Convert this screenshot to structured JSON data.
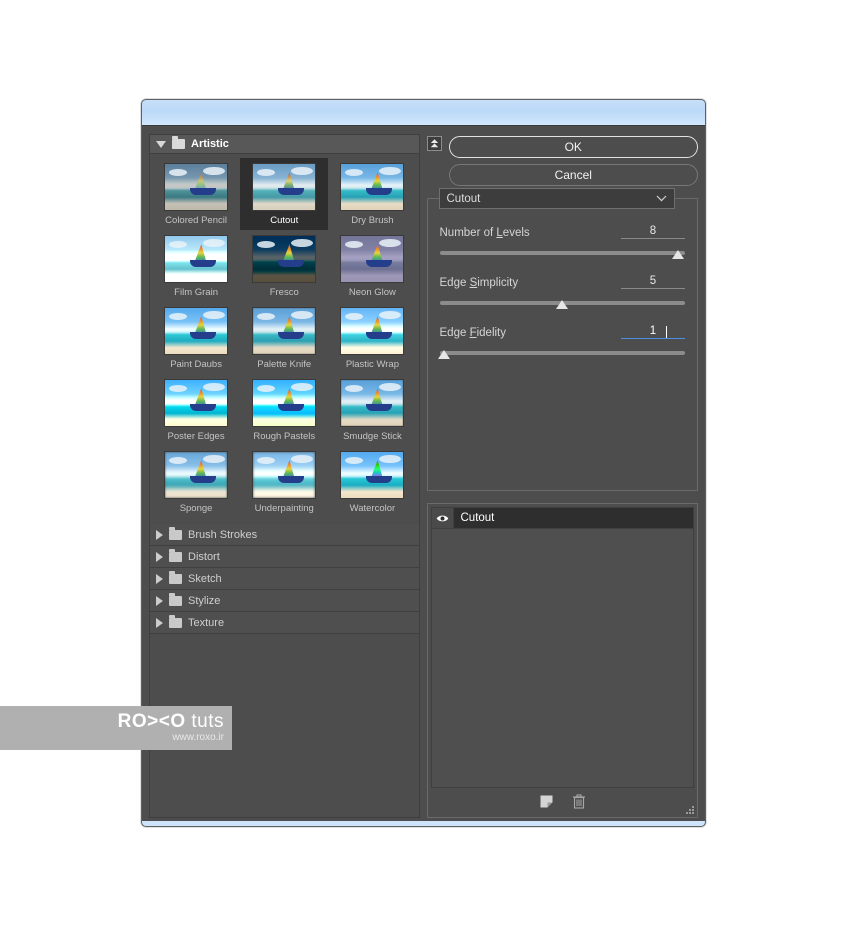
{
  "window": {
    "titlebar_color": "#c2ddf9",
    "background_color": "#4d4d4d"
  },
  "filter_browser": {
    "expanded_category": {
      "label": "Artistic",
      "icon": "folder-open-icon",
      "disclosure": "triangle-down-icon"
    },
    "filters": [
      {
        "label": "Colored Pencil",
        "variant": "v-colored-pencil",
        "selected": false
      },
      {
        "label": "Cutout",
        "variant": "v-cutout",
        "selected": true
      },
      {
        "label": "Dry Brush",
        "variant": "v-drybrush",
        "selected": false
      },
      {
        "label": "Film Grain",
        "variant": "v-filmgrain",
        "selected": false
      },
      {
        "label": "Fresco",
        "variant": "v-fresco",
        "selected": false
      },
      {
        "label": "Neon Glow",
        "variant": "v-neonglow",
        "selected": false
      },
      {
        "label": "Paint Daubs",
        "variant": "v-paintdaubs",
        "selected": false
      },
      {
        "label": "Palette Knife",
        "variant": "v-palette",
        "selected": false
      },
      {
        "label": "Plastic Wrap",
        "variant": "v-plasticwrap",
        "selected": false
      },
      {
        "label": "Poster Edges",
        "variant": "v-posteredges",
        "selected": false
      },
      {
        "label": "Rough Pastels",
        "variant": "v-roughpastels",
        "selected": false
      },
      {
        "label": "Smudge Stick",
        "variant": "v-smudge",
        "selected": false
      },
      {
        "label": "Sponge",
        "variant": "v-sponge",
        "selected": false
      },
      {
        "label": "Underpainting",
        "variant": "v-underpaint",
        "selected": false
      },
      {
        "label": "Watercolor",
        "variant": "v-watercolor",
        "selected": false
      }
    ],
    "collapsed_categories": [
      {
        "label": "Brush Strokes"
      },
      {
        "label": "Distort"
      },
      {
        "label": "Sketch"
      },
      {
        "label": "Stylize"
      },
      {
        "label": "Texture"
      }
    ]
  },
  "controls": {
    "collapse_button_icon": "double-chevron-up-icon",
    "ok_label": "OK",
    "cancel_label": "Cancel",
    "filter_select": {
      "value": "Cutout",
      "icon": "chevron-down-icon"
    },
    "parameters": [
      {
        "label_before": "Number of ",
        "label_accel": "L",
        "label_after": "evels",
        "value": "8",
        "min": 2,
        "max": 8,
        "percent": 97,
        "focused": false
      },
      {
        "label_before": "Edge ",
        "label_accel": "S",
        "label_after": "implicity",
        "value": "5",
        "min": 0,
        "max": 10,
        "percent": 50,
        "focused": false
      },
      {
        "label_before": "Edge ",
        "label_accel": "F",
        "label_after": "idelity",
        "value": "1",
        "min": 1,
        "max": 3,
        "percent": 2,
        "focused": true
      }
    ]
  },
  "layers": {
    "items": [
      {
        "name": "Cutout",
        "visible": true,
        "eye_icon": "eye-icon",
        "selected": true
      }
    ],
    "toolbar": {
      "new_effect_layer_icon": "new-effect-layer-icon",
      "delete_layer_icon": "trash-icon"
    }
  },
  "watermark": {
    "brand_prefix": "RO",
    "brand_mark": "><",
    "brand_suffix": "O",
    "brand_word": "tuts",
    "url": "www.roxo.ir"
  }
}
